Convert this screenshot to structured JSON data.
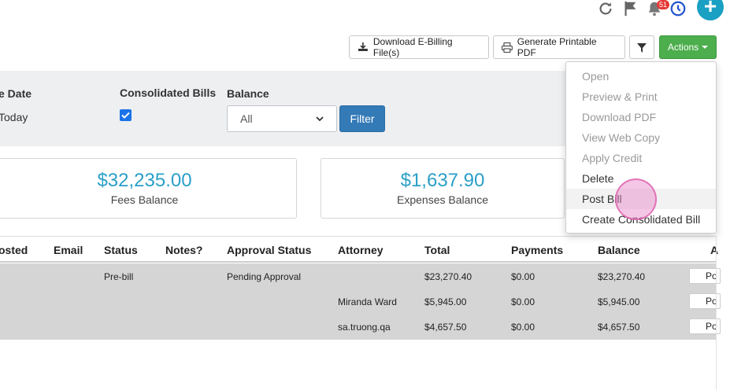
{
  "header": {
    "notification_count": "51",
    "icons": [
      "refresh-icon",
      "flag-icon",
      "bell-icon",
      "clock-icon",
      "plus-icon"
    ],
    "plus_label": "+"
  },
  "toolbar": {
    "download_ebilling": "Download E-Billing File(s)",
    "generate_pdf": "Generate Printable PDF",
    "actions": "Actions"
  },
  "filters": {
    "date_label": "e Date",
    "date_value": "Today",
    "consolidated_label": "Consolidated Bills",
    "consolidated_checked": true,
    "balance_label": "Balance",
    "balance_value": "All",
    "filter_button": "Filter"
  },
  "summary": {
    "fees_amount": "$32,235.00",
    "fees_label": "Fees Balance",
    "expenses_amount": "$1,637.90",
    "expenses_label": "Expenses Balance"
  },
  "table": {
    "headers": [
      "osted",
      "Email",
      "Status",
      "Notes?",
      "Approval Status",
      "Attorney",
      "Total",
      "Payments",
      "Balance",
      "A"
    ],
    "rows": [
      {
        "status": "Pre-bill",
        "approval": "Pending Approval",
        "attorney": "",
        "total": "$23,270.40",
        "payments": "$0.00",
        "balance": "$23,270.40",
        "action": "Po"
      },
      {
        "status": "",
        "approval": "",
        "attorney": "Miranda Ward",
        "total": "$5,945.00",
        "payments": "$0.00",
        "balance": "$5,945.00",
        "action": "Po"
      },
      {
        "status": "",
        "approval": "",
        "attorney": "sa.truong.qa",
        "total": "$4,657.50",
        "payments": "$0.00",
        "balance": "$4,657.50",
        "action": "Po"
      }
    ]
  },
  "actions_menu": {
    "items": [
      {
        "label": "Open",
        "enabled": false
      },
      {
        "label": "Preview & Print",
        "enabled": false
      },
      {
        "label": "Download PDF",
        "enabled": false
      },
      {
        "label": "View Web Copy",
        "enabled": false
      },
      {
        "label": "Apply Credit",
        "enabled": false
      },
      {
        "label": "Delete",
        "enabled": true
      },
      {
        "label": "Post Bill",
        "enabled": true
      },
      {
        "label": "Create Consolidated Bill",
        "enabled": true
      }
    ]
  },
  "colors": {
    "accent": "#2a9fc7",
    "primary_button": "#337ab7",
    "success_button": "#4cae4c",
    "badge": "#e53935",
    "plus_button": "#1aa0c3"
  }
}
